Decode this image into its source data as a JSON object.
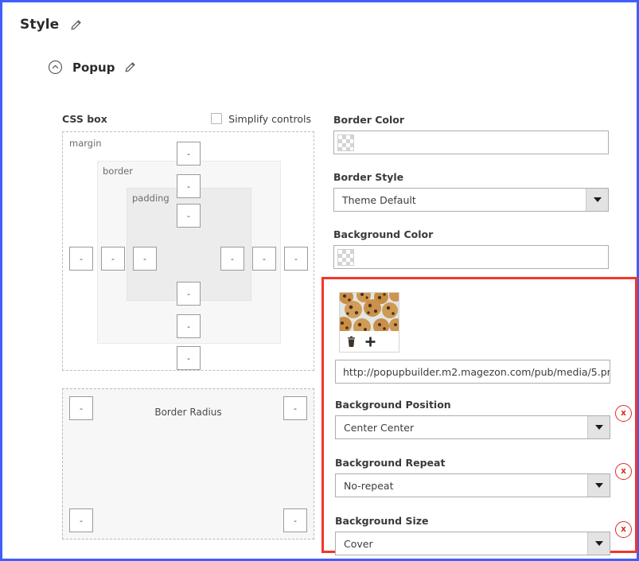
{
  "header": {
    "title": "Style",
    "edit_icon": "pencil-icon"
  },
  "section": {
    "collapse_icon": "chevron-up-circle-icon",
    "title": "Popup",
    "edit_icon": "pencil-icon"
  },
  "css_box": {
    "label": "CSS box",
    "simplify_label": "Simplify controls",
    "simplify_checked": false,
    "zones": {
      "margin": "margin",
      "border": "border",
      "padding": "padding"
    },
    "input_value": "-",
    "inputs": [
      "-",
      "-",
      "-",
      "-",
      "-",
      "-",
      "-",
      "-",
      "-",
      "-",
      "-",
      "-"
    ]
  },
  "border_radius": {
    "label": "Border Radius",
    "corners": [
      "-",
      "-",
      "-",
      "-"
    ]
  },
  "fields": {
    "border_color": {
      "label": "Border Color",
      "value": "",
      "swatch": "transparent-checkerboard"
    },
    "border_style": {
      "label": "Border Style",
      "value": "Theme Default",
      "caret_icon": "chevron-down-icon"
    },
    "background_color": {
      "label": "Background Color",
      "value": "",
      "swatch": "transparent-checkerboard"
    }
  },
  "background_image": {
    "thumbnail_alt": "chocolate-chip-cookies-thumbnail",
    "delete_icon": "trash-icon",
    "add_icon": "plus-icon",
    "url": "http://popupbuilder.m2.magezon.com/pub/media/5.pr"
  },
  "background_options": [
    {
      "label": "Background Position",
      "value": "Center Center",
      "caret_icon": "chevron-down-icon",
      "clear_icon": "x",
      "clear_name": "clear-background-position"
    },
    {
      "label": "Background Repeat",
      "value": "No-repeat",
      "caret_icon": "chevron-down-icon",
      "clear_icon": "x",
      "clear_name": "clear-background-repeat"
    },
    {
      "label": "Background Size",
      "value": "Cover",
      "caret_icon": "chevron-down-icon",
      "clear_icon": "x",
      "clear_name": "clear-background-size"
    }
  ],
  "colors": {
    "window_border": "#3f5efb",
    "highlight_border": "#f5342a",
    "clear_button": "#e02b20",
    "border_zone_bg": "#f7f7f7",
    "padding_zone_bg": "#ececec"
  }
}
